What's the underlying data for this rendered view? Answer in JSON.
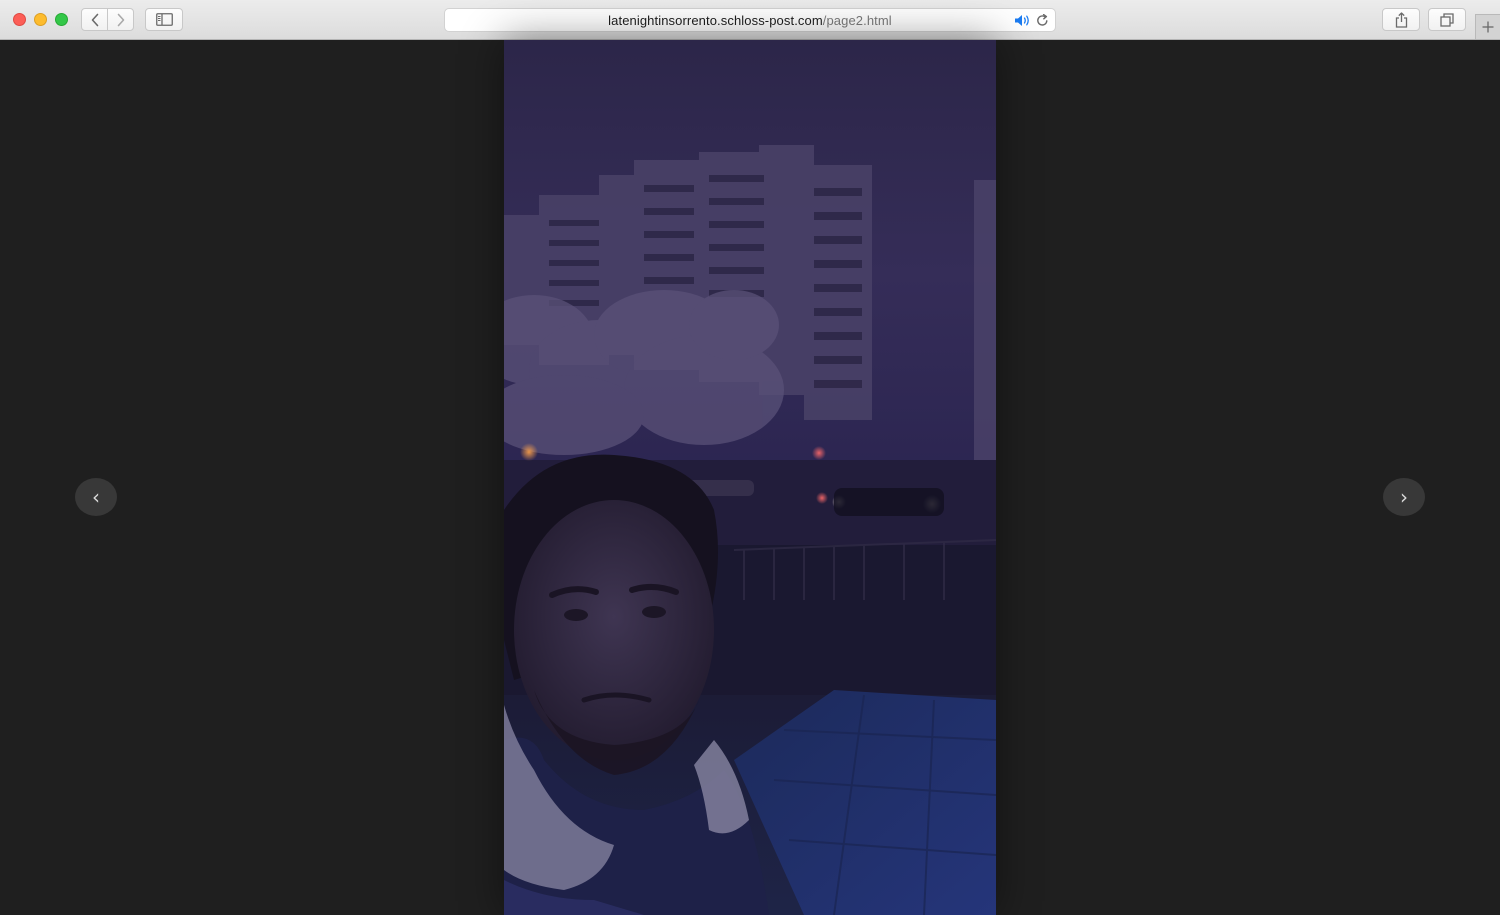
{
  "browser": {
    "url_host": "latenightinsorrento.schloss-post.com",
    "url_path": "/page2.html",
    "icons": {
      "close": "close-window-icon",
      "minimize": "minimize-window-icon",
      "maximize": "maximize-window-icon",
      "back": "chevron-left-icon",
      "forward": "chevron-right-icon",
      "sidebar": "sidebar-icon",
      "speaker": "speaker-icon",
      "reload": "reload-icon",
      "share": "share-icon",
      "tabs": "tabs-overview-icon",
      "new_tab": "plus-icon"
    },
    "colors": {
      "traffic_close": "#fc5e57",
      "traffic_min": "#fdbc2e",
      "traffic_max": "#33c748",
      "speaker_accent": "#1b7cf2"
    }
  },
  "gallery": {
    "prev_label": "‹",
    "next_label": "›",
    "background": "#1f1f1f"
  }
}
